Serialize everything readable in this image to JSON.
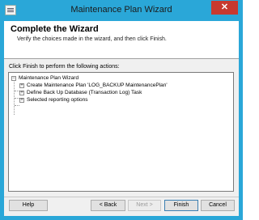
{
  "window": {
    "title": "Maintenance Plan Wizard",
    "close_label": "✕"
  },
  "header": {
    "title": "Complete the Wizard",
    "subtitle": "Verify the choices made in the wizard, and then click Finish."
  },
  "main": {
    "actions_label": "Click Finish to perform the following actions:",
    "tree": {
      "root": {
        "label": "Maintenance Plan Wizard",
        "expander": "−"
      },
      "children": [
        {
          "label": "Create Maintenance Plan 'LOG_BACKUP MaintenancePlan'",
          "expander": "+"
        },
        {
          "label": "Define Back Up Database (Transaction Log) Task",
          "expander": "+"
        },
        {
          "label": "Selected reporting options",
          "expander": "+"
        }
      ]
    }
  },
  "footer": {
    "help": "Help",
    "back": "< Back",
    "next": "Next >",
    "finish": "Finish",
    "cancel": "Cancel"
  },
  "colors": {
    "titlebar": "#2aa7d8",
    "close": "#c7392f"
  }
}
